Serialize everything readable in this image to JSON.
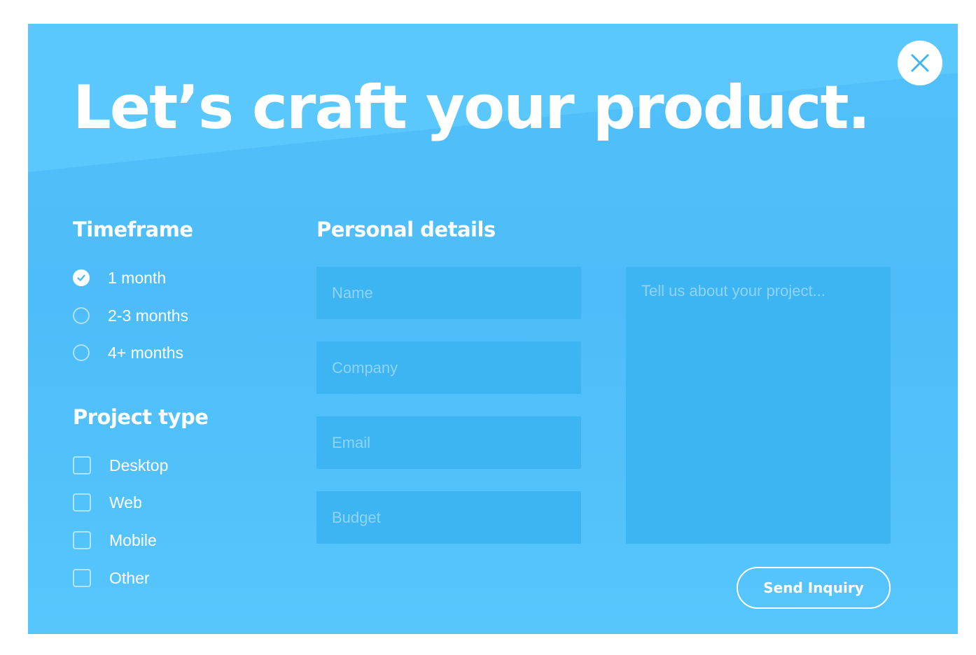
{
  "title": "Let’s craft your product.",
  "close_icon": "close-icon",
  "timeframe": {
    "heading": "Timeframe",
    "options": [
      {
        "label": "1 month",
        "selected": true
      },
      {
        "label": "2-3 months",
        "selected": false
      },
      {
        "label": "4+ months",
        "selected": false
      }
    ]
  },
  "project_type": {
    "heading": "Project type",
    "options": [
      {
        "label": "Desktop",
        "checked": false
      },
      {
        "label": "Web",
        "checked": false
      },
      {
        "label": "Mobile",
        "checked": false
      },
      {
        "label": "Other",
        "checked": false
      }
    ]
  },
  "personal_details": {
    "heading": "Personal details",
    "name_placeholder": "Name",
    "company_placeholder": "Company",
    "email_placeholder": "Email",
    "budget_placeholder": "Budget",
    "name_value": "",
    "company_value": "",
    "email_value": "",
    "budget_value": ""
  },
  "project_description": {
    "placeholder": "Tell us about your project...",
    "value": ""
  },
  "send_button": "Send Inquiry",
  "colors": {
    "background": "#52c1fa",
    "field": "#3db5f3",
    "text": "#ffffff"
  }
}
